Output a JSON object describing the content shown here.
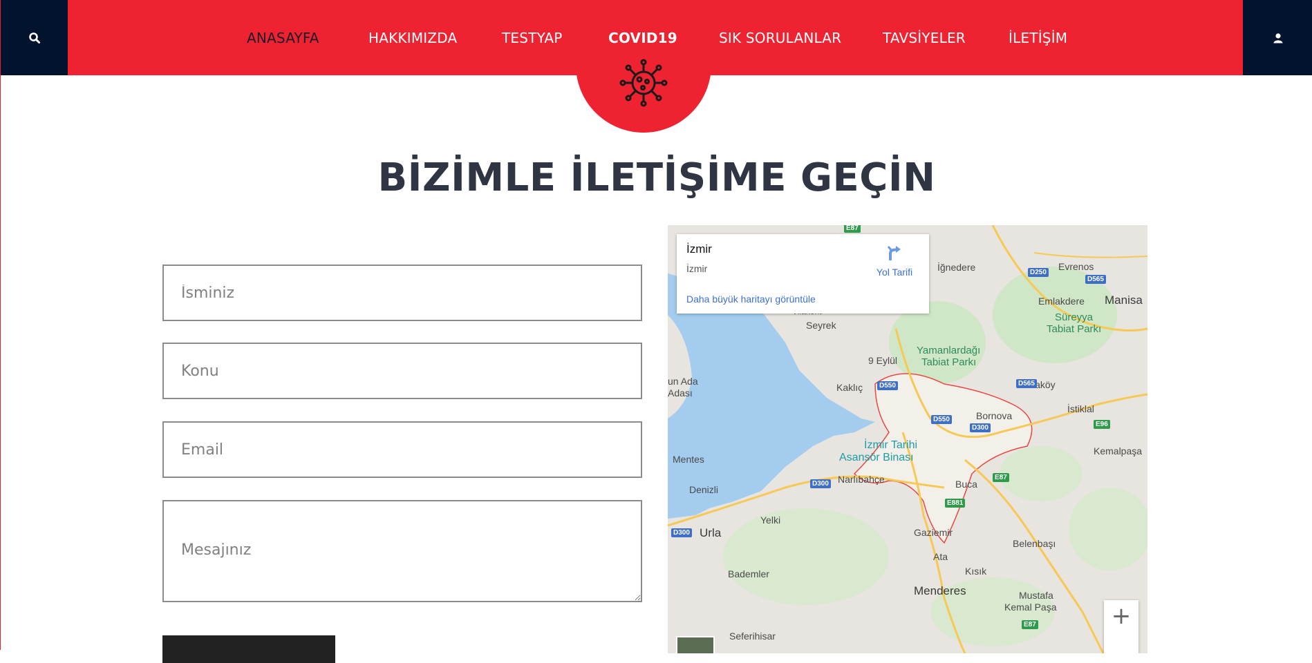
{
  "header": {
    "nav": [
      {
        "label": "ANASAYFA"
      },
      {
        "label": "HAKKIMIZDA"
      },
      {
        "label": "TESTYAP"
      },
      {
        "label": "COVID19"
      },
      {
        "label": "SIK SORULANLAR"
      },
      {
        "label": "TAVSİYELER"
      },
      {
        "label": "İLETİŞİM"
      }
    ],
    "left_icon": "search-icon",
    "right_icon": "user-icon",
    "badge_icon": "virus-icon"
  },
  "page_title": "BİZİMLE İLETİŞİME GEÇİN",
  "form": {
    "name_placeholder": "İsminiz",
    "subject_placeholder": "Konu",
    "email_placeholder": "Email",
    "message_placeholder": "Mesajınız"
  },
  "map": {
    "card": {
      "title": "İzmir",
      "subtitle": "İzmir",
      "directions": "Yol Tarifi",
      "larger_map": "Daha büyük haritayı görüntüle"
    },
    "places": [
      "İğnedere",
      "Evrenos",
      "Emlakdere",
      "Manisa",
      "Süreyya",
      "Tabiat Parkı",
      "Vilakent",
      "Seyrek",
      "Yamanlardağı",
      "Tabiat Parkı",
      "9 Eylül",
      "Kaklıç",
      "Yakaköy",
      "İstiklal",
      "Bornova",
      "Kemalpaşa",
      "Mentes",
      "İzmir Tarihi",
      "Asansör Binası",
      "Narlıbahçe",
      "Buca",
      "Denizli",
      "Urla",
      "Yelki",
      "Gaziemir",
      "Belenbaşı",
      "Ata",
      "Kısık",
      "Bademler",
      "Menderes",
      "Mustafa",
      "Kemal Paşa",
      "Seferihisar",
      "un Ada",
      "Adası"
    ],
    "roads": [
      "E87",
      "D250",
      "D565",
      "D550",
      "D565",
      "D550",
      "D300",
      "E96",
      "D300",
      "E87",
      "E881",
      "D300",
      "E87"
    ],
    "zoom_in": "+",
    "colors": {
      "water": "#a3ccef",
      "land": "#e8e4df",
      "park": "#cfe6c7",
      "road": "#f6c954",
      "boundary": "#e8463e"
    }
  },
  "colors": {
    "brand_red": "#ee2230",
    "navy": "#02142d",
    "title": "#2f3542"
  }
}
